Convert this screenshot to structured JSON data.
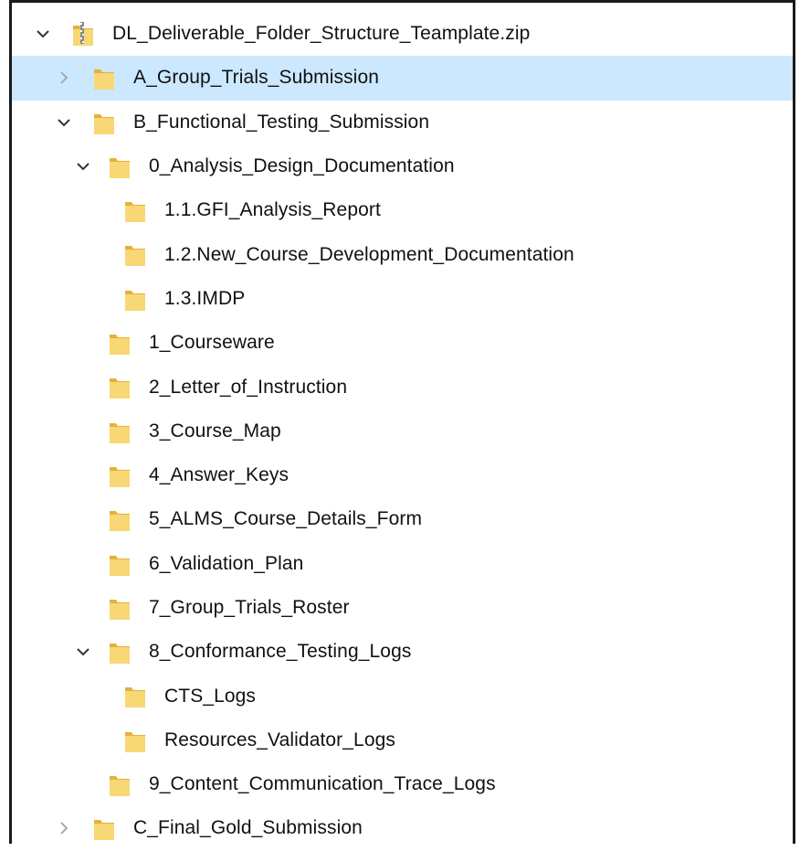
{
  "tree": [
    {
      "label": "DL_Deliverable_Folder_Structure_Teamplate.zip",
      "level": 0,
      "expand": "expanded",
      "icon": "zip-folder-icon",
      "selected": false
    },
    {
      "label": "A_Group_Trials_Submission",
      "level": 1,
      "expand": "collapsed",
      "icon": "folder-icon",
      "selected": true
    },
    {
      "label": "B_Functional_Testing_Submission",
      "level": 1,
      "expand": "expanded",
      "icon": "folder-icon",
      "selected": false
    },
    {
      "label": "0_Analysis_Design_Documentation",
      "level": 2,
      "expand": "expanded",
      "icon": "folder-icon",
      "selected": false
    },
    {
      "label": "1.1.GFI_Analysis_Report",
      "level": 3,
      "expand": "none",
      "icon": "folder-icon",
      "selected": false
    },
    {
      "label": "1.2.New_Course_Development_Documentation",
      "level": 3,
      "expand": "none",
      "icon": "folder-icon",
      "selected": false
    },
    {
      "label": "1.3.IMDP",
      "level": 3,
      "expand": "none",
      "icon": "folder-icon",
      "selected": false
    },
    {
      "label": "1_Courseware",
      "level": 2,
      "expand": "none",
      "icon": "folder-icon",
      "selected": false
    },
    {
      "label": "2_Letter_of_Instruction",
      "level": 2,
      "expand": "none",
      "icon": "folder-icon",
      "selected": false
    },
    {
      "label": "3_Course_Map",
      "level": 2,
      "expand": "none",
      "icon": "folder-icon",
      "selected": false
    },
    {
      "label": "4_Answer_Keys",
      "level": 2,
      "expand": "none",
      "icon": "folder-icon",
      "selected": false
    },
    {
      "label": "5_ALMS_Course_Details_Form",
      "level": 2,
      "expand": "none",
      "icon": "folder-icon",
      "selected": false
    },
    {
      "label": "6_Validation_Plan",
      "level": 2,
      "expand": "none",
      "icon": "folder-icon",
      "selected": false
    },
    {
      "label": "7_Group_Trials_Roster",
      "level": 2,
      "expand": "none",
      "icon": "folder-icon",
      "selected": false
    },
    {
      "label": "8_Conformance_Testing_Logs",
      "level": 2,
      "expand": "expanded",
      "icon": "folder-icon",
      "selected": false
    },
    {
      "label": "CTS_Logs",
      "level": 3,
      "expand": "none",
      "icon": "folder-icon",
      "selected": false
    },
    {
      "label": "Resources_Validator_Logs",
      "level": 3,
      "expand": "none",
      "icon": "folder-icon",
      "selected": false
    },
    {
      "label": "9_Content_Communication_Trace_Logs",
      "level": 2,
      "expand": "none",
      "icon": "folder-icon",
      "selected": false
    },
    {
      "label": "C_Final_Gold_Submission",
      "level": 1,
      "expand": "collapsed",
      "icon": "folder-icon",
      "selected": false
    }
  ],
  "colors": {
    "selection": "#cce8ff",
    "folder": "#f8d775",
    "folder_dark": "#e3b23c",
    "chevron": "#333333"
  }
}
